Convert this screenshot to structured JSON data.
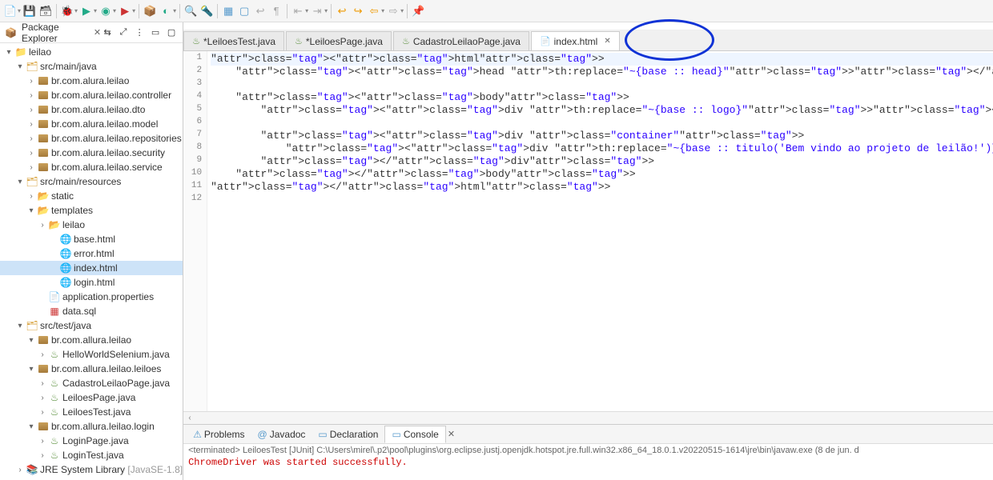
{
  "sidebar": {
    "title": "Package Explorer",
    "project": "leilao",
    "srcMainJava": "src/main/java",
    "srcMainResources": "src/main/resources",
    "srcTestJava": "src/test/java",
    "jre": "JRE System Library",
    "jreVersion": "[JavaSE-1.8]",
    "pkgs_main": [
      "br.com.alura.leilao",
      "br.com.alura.leilao.controller",
      "br.com.alura.leilao.dto",
      "br.com.alura.leilao.model",
      "br.com.alura.leilao.repositories",
      "br.com.alura.leilao.security",
      "br.com.alura.leilao.service"
    ],
    "res_static": "static",
    "res_templates": "templates",
    "res_leilao": "leilao",
    "tpl_files": [
      "base.html",
      "error.html",
      "index.html",
      "login.html"
    ],
    "app_props": "application.properties",
    "data_sql": "data.sql",
    "test_pkg1": "br.com.allura.leilao",
    "test_file1": "HelloWorldSelenium.java",
    "test_pkg2": "br.com.allura.leilao.leiloes",
    "test_files2": [
      "CadastroLeilaoPage.java",
      "LeiloesPage.java",
      "LeiloesTest.java"
    ],
    "test_pkg3": "br.com.allura.leilao.login",
    "test_files3": [
      "LoginPage.java",
      "LoginTest.java"
    ]
  },
  "tabs": [
    {
      "icon": "J",
      "label": "*LeiloesTest.java",
      "active": false
    },
    {
      "icon": "J",
      "label": "*LeiloesPage.java",
      "active": false
    },
    {
      "icon": "J",
      "label": "CadastroLeilaoPage.java",
      "active": false
    },
    {
      "icon": "H",
      "label": "index.html",
      "active": true,
      "closeable": true
    }
  ],
  "code": {
    "lines": [
      "<html>",
      "    <head th:replace=\"~{base :: head}\"></head>",
      "",
      "    <body>",
      "        <div th:replace=\"~{base :: logo}\"></div>",
      "",
      "        <div class=\"container\">",
      "            <div th:replace=\"~{base :: titulo('Bem vindo ao projeto de leilão!')}\"></div>",
      "        </div>",
      "    </body>",
      "</html>",
      ""
    ]
  },
  "bottom": {
    "tabs": [
      "Problems",
      "Javadoc",
      "Declaration",
      "Console"
    ],
    "status": "<terminated> LeiloesTest [JUnit] C:\\Users\\mirel\\.p2\\pool\\plugins\\org.eclipse.justj.openjdk.hotspot.jre.full.win32.x86_64_18.0.1.v20220515-1614\\jre\\bin\\javaw.exe  (8 de jun. d",
    "console": "ChromeDriver was started successfully."
  }
}
